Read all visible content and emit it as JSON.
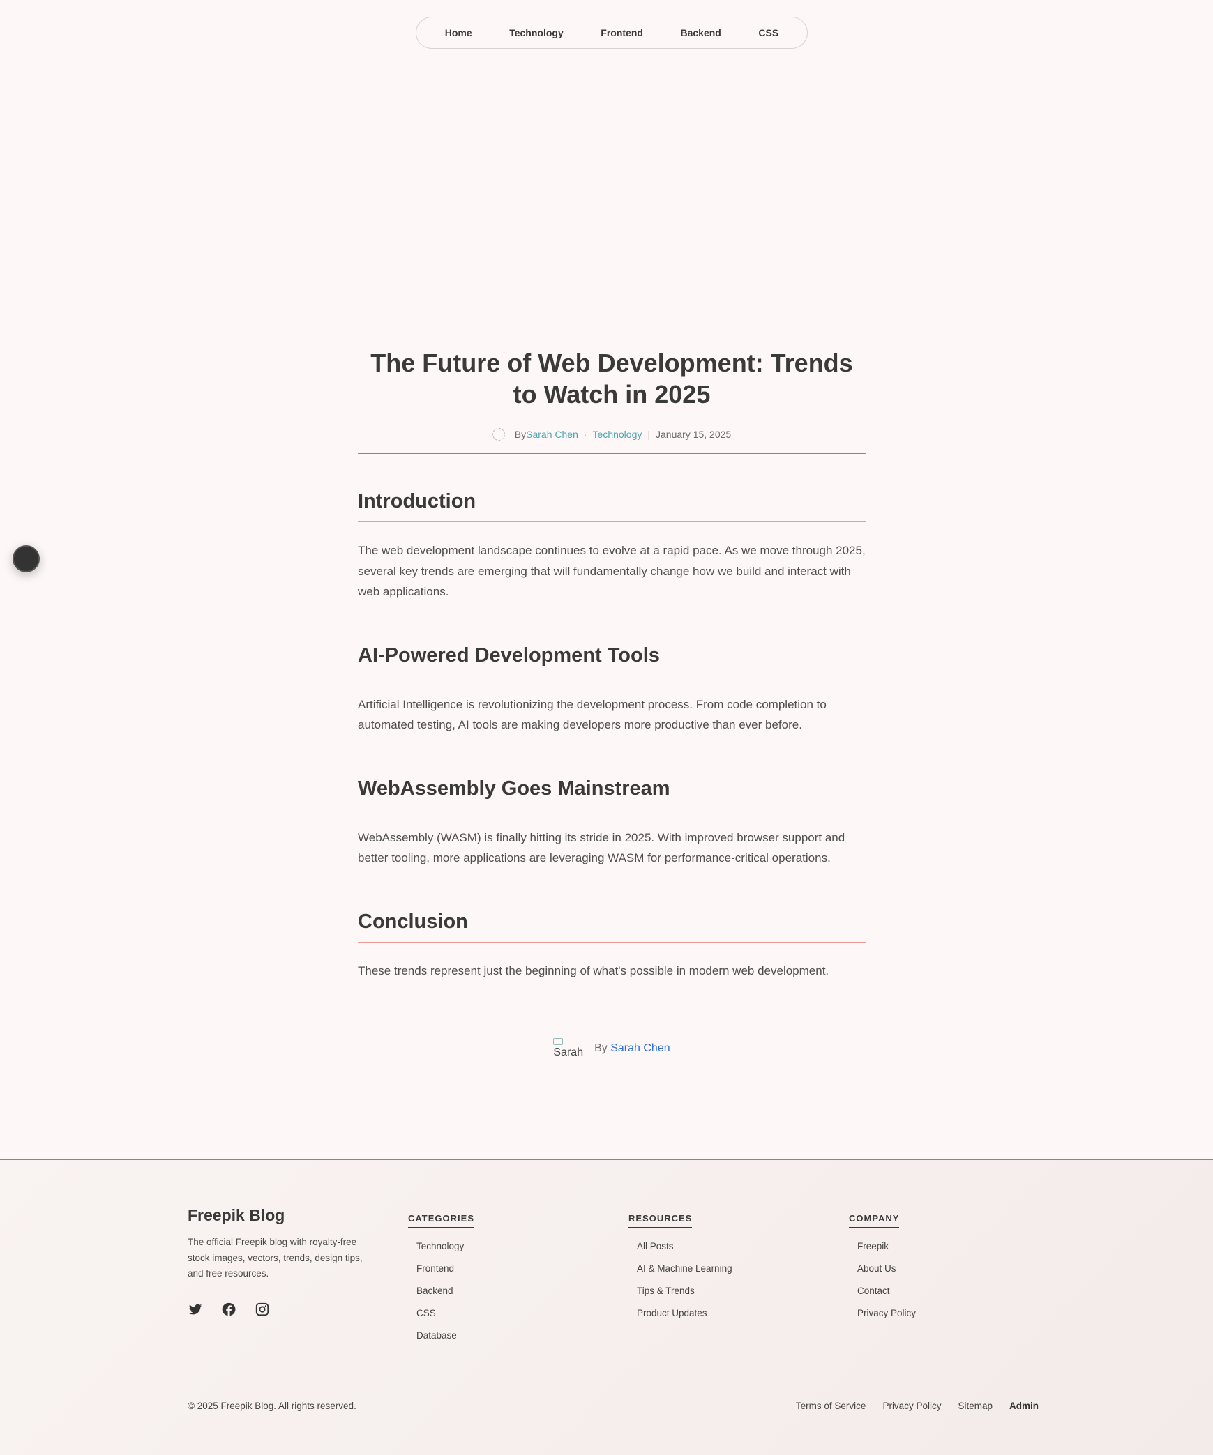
{
  "nav": {
    "items": [
      "Home",
      "Technology",
      "Frontend",
      "Backend",
      "CSS"
    ]
  },
  "article": {
    "title": "The Future of Web Development: Trends to Watch in 2025",
    "meta": {
      "by": "By",
      "author": "Sarah Chen",
      "dot": "·",
      "category": "Technology",
      "divider": "|",
      "date": "January 15, 2025"
    },
    "sections": [
      {
        "heading": "Introduction",
        "body": "The web development landscape continues to evolve at a rapid pace. As we move through 2025, several key trends are emerging that will fundamentally change how we build and interact with web applications."
      },
      {
        "heading": "AI-Powered Development Tools",
        "body": "Artificial Intelligence is revolutionizing the development process. From code completion to automated testing, AI tools are making developers more productive than ever before."
      },
      {
        "heading": "WebAssembly Goes Mainstream",
        "body": "WebAssembly (WASM) is finally hitting its stride in 2025. With improved browser support and better tooling, more applications are leveraging WASM for performance-critical operations."
      },
      {
        "heading": "Conclusion",
        "body": "These trends represent just the beginning of what's possible in modern web development."
      }
    ],
    "author_box": {
      "img_alt": "Sarah",
      "by": "By",
      "name": "Sarah Chen"
    }
  },
  "footer": {
    "brand": {
      "title": "Freepik Blog",
      "description": "The official Freepik blog with royalty-free stock images, vectors, trends, design tips, and free resources.",
      "socials": [
        "twitter-icon",
        "facebook-icon",
        "instagram-icon"
      ]
    },
    "columns": [
      {
        "heading": "CATEGORIES",
        "items": [
          "Technology",
          "Frontend",
          "Backend",
          "CSS",
          "Database"
        ]
      },
      {
        "heading": "RESOURCES",
        "items": [
          "All Posts",
          "AI & Machine Learning",
          "Tips & Trends",
          "Product Updates"
        ]
      },
      {
        "heading": "COMPANY",
        "items": [
          "Freepik",
          "About Us",
          "Contact",
          "Privacy Policy"
        ]
      }
    ],
    "copyright": "© 2025 Freepik Blog. All rights reserved.",
    "legal": [
      "Terms of Service",
      "Privacy Policy",
      "Sitemap",
      "Admin"
    ]
  },
  "colors": {
    "background": "#fdf8f7",
    "accent_teal": "#4aa6b0",
    "rule_blue": "#5f95a2",
    "heading_rule": "#ee9c96",
    "author_link": "#2f6fd1"
  }
}
